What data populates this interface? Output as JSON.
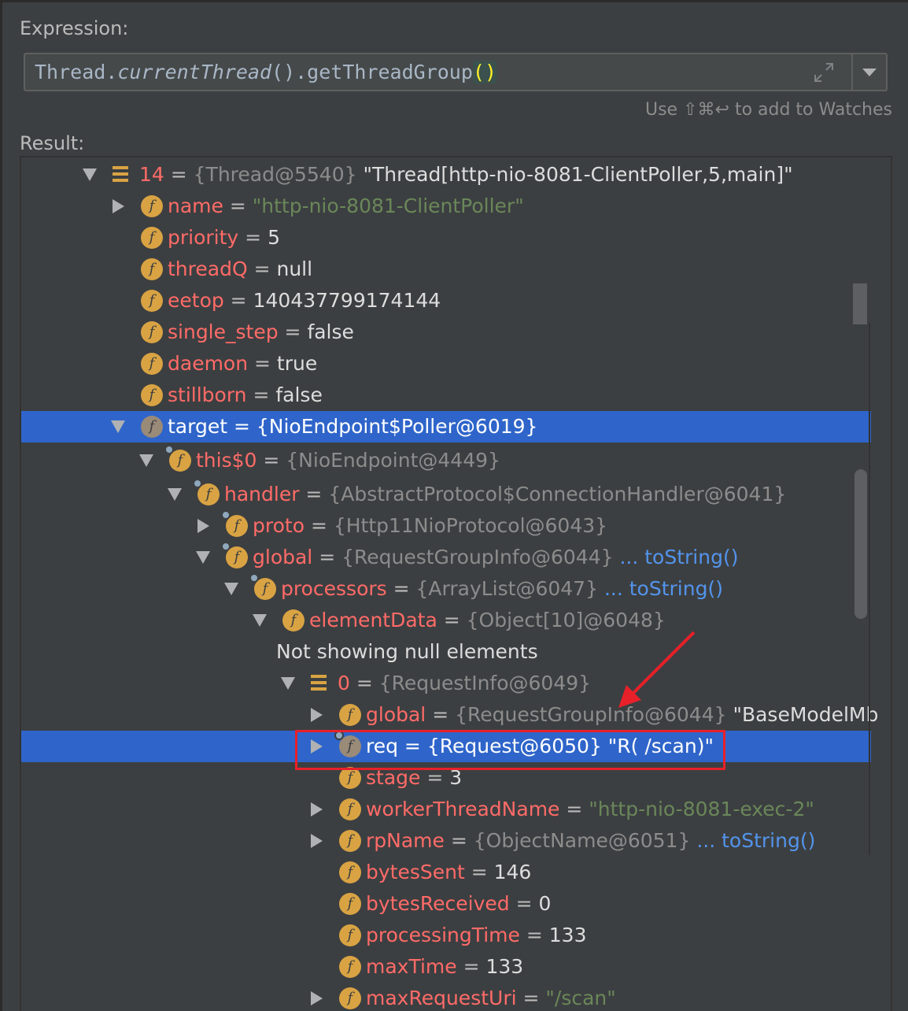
{
  "expression": {
    "label": "Expression:",
    "text_prefix": "Thread.",
    "text_italic": "currentThread",
    "text_suffix": "().getThreadGroup",
    "text_parens": "()",
    "hint": "Use ⇧⌘↩ to add to Watches"
  },
  "result": {
    "label": "Result:",
    "rows": [
      {
        "name": "14",
        "eq": " = ",
        "type": "{Thread@5540}",
        "value": " \"Thread[http-nio-8081-ClientPoller,5,main]\"",
        "icon": "array-icon",
        "arrow": "down"
      },
      {
        "name": "name",
        "eq": " = ",
        "value": "\"http-nio-8081-ClientPoller\"",
        "icon": "field-icon",
        "arrow": "right"
      },
      {
        "name": "priority",
        "eq": " = ",
        "value": "5",
        "icon": "field-icon",
        "arrow": "none"
      },
      {
        "name": "threadQ",
        "eq": " = ",
        "value": "null",
        "icon": "field-icon",
        "arrow": "none"
      },
      {
        "name": "eetop",
        "eq": " = ",
        "value": "140437799174144",
        "icon": "field-icon",
        "arrow": "none"
      },
      {
        "name": "single_step",
        "eq": " = ",
        "value": "false",
        "icon": "field-icon",
        "arrow": "none"
      },
      {
        "name": "daemon",
        "eq": " = ",
        "value": "true",
        "icon": "field-icon",
        "arrow": "none"
      },
      {
        "name": "stillborn",
        "eq": " = ",
        "value": "false",
        "icon": "field-icon",
        "arrow": "none"
      },
      {
        "name": "target",
        "eq": " = ",
        "type": "{NioEndpoint$Poller@6019}",
        "icon": "field-icon",
        "arrow": "down",
        "selected": true
      },
      {
        "name": "this$0",
        "eq": " = ",
        "type": "{NioEndpoint@4449}",
        "icon": "field-icon",
        "arrow": "down"
      },
      {
        "name": "handler",
        "eq": " = ",
        "type": "{AbstractProtocol$ConnectionHandler@6041}",
        "icon": "field-icon",
        "arrow": "down"
      },
      {
        "name": "proto",
        "eq": " = ",
        "type": "{Http11NioProtocol@6043}",
        "icon": "field-icon",
        "arrow": "right"
      },
      {
        "name": "global",
        "eq": " = ",
        "type": "{RequestGroupInfo@6044}",
        "link": " ... toString()",
        "icon": "field-icon",
        "arrow": "down"
      },
      {
        "name": "processors",
        "eq": " = ",
        "type": "{ArrayList@6047}",
        "link": " ... toString()",
        "icon": "field-icon",
        "arrow": "down"
      },
      {
        "name": "elementData",
        "eq": " = ",
        "type": "{Object[10]@6048}",
        "icon": "field-icon",
        "arrow": "down"
      },
      {
        "plain": "Not showing null elements"
      },
      {
        "name": "0",
        "eq": " = ",
        "type": "{RequestInfo@6049}",
        "icon": "array-icon",
        "arrow": "down"
      },
      {
        "name": "global",
        "eq": " = ",
        "type": "{RequestGroupInfo@6044}",
        "value": " \"BaseModelMb",
        "icon": "field-icon",
        "arrow": "right"
      },
      {
        "name": "req",
        "eq": " = ",
        "type": "{Request@6050}",
        "value": " \"R( /scan)\"",
        "icon": "field-icon",
        "arrow": "right",
        "selected": true
      },
      {
        "name": "stage",
        "eq": " = ",
        "value": "3",
        "icon": "field-icon",
        "arrow": "none"
      },
      {
        "name": "workerThreadName",
        "eq": " = ",
        "value": "\"http-nio-8081-exec-2\"",
        "icon": "field-icon",
        "arrow": "right"
      },
      {
        "name": "rpName",
        "eq": " = ",
        "type": "{ObjectName@6051}",
        "link": " ... toString()",
        "icon": "field-icon",
        "arrow": "right"
      },
      {
        "name": "bytesSent",
        "eq": " = ",
        "value": "146",
        "icon": "field-icon",
        "arrow": "none"
      },
      {
        "name": "bytesReceived",
        "eq": " = ",
        "value": "0",
        "icon": "field-icon",
        "arrow": "none"
      },
      {
        "name": "processingTime",
        "eq": " = ",
        "value": "133",
        "icon": "field-icon",
        "arrow": "none"
      },
      {
        "name": "maxTime",
        "eq": " = ",
        "value": "133",
        "icon": "field-icon",
        "arrow": "none"
      },
      {
        "name": "maxRequestUri",
        "eq": " = ",
        "value": "\"/scan\"",
        "icon": "field-icon",
        "arrow": "right"
      }
    ]
  },
  "colors": {
    "background": "#3c3f41",
    "selection": "#2f65ca",
    "field_name": "#ff6b68",
    "string_value": "#6a8759",
    "type_ref": "#8c8c8c",
    "link": "#5394ec",
    "annotation_red": "#e8202a"
  }
}
